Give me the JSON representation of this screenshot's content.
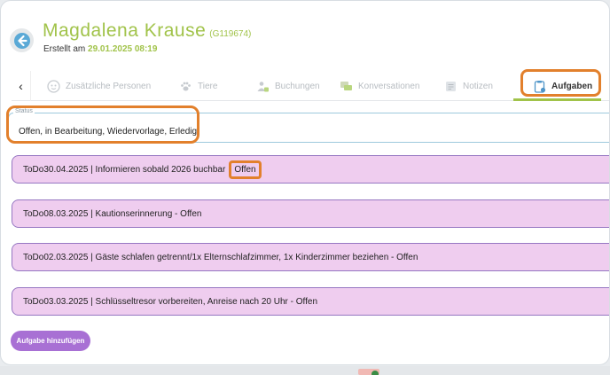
{
  "header": {
    "name": "Magdalena Krause",
    "id": "(G119674)",
    "created_label": "Erstellt am",
    "created_value": "29.01.2025 08:19"
  },
  "tabs": [
    {
      "label": "Zusätzliche Personen",
      "icon": "persons-icon"
    },
    {
      "label": "Tiere",
      "icon": "paw-icon"
    },
    {
      "label": "Buchungen",
      "icon": "booking-icon"
    },
    {
      "label": "Konversationen",
      "icon": "chat-icon"
    },
    {
      "label": "Notizen",
      "icon": "notes-icon"
    },
    {
      "label": "Aufgaben",
      "icon": "clipboard-icon",
      "active": true
    }
  ],
  "status": {
    "legend": "Status",
    "value": "Offen, in Bearbeitung, Wiedervorlage, Erledigt"
  },
  "todos": [
    {
      "text": "ToDo30.04.2025 | Informieren sobald 2026 buchbar",
      "status": "Offen"
    },
    {
      "text": "ToDo08.03.2025 | Kautionserinnerung - Offen"
    },
    {
      "text": "ToDo02.03.2025 | Gäste schlafen getrennt/1x Elternschlafzimmer, 1x Kinderzimmer beziehen - Offen"
    },
    {
      "text": "ToDo03.03.2025 | Schlüsseltresor vorbereiten, Anreise nach 20 Uhr - Offen"
    }
  ],
  "add_button": "Aufgabe hinzufügen",
  "colors": {
    "accent_green": "#a1c34a",
    "todo_bg": "#efcdef",
    "todo_border": "#9677c2",
    "button_purple": "#a870d4",
    "highlight_orange": "#e2802c"
  }
}
